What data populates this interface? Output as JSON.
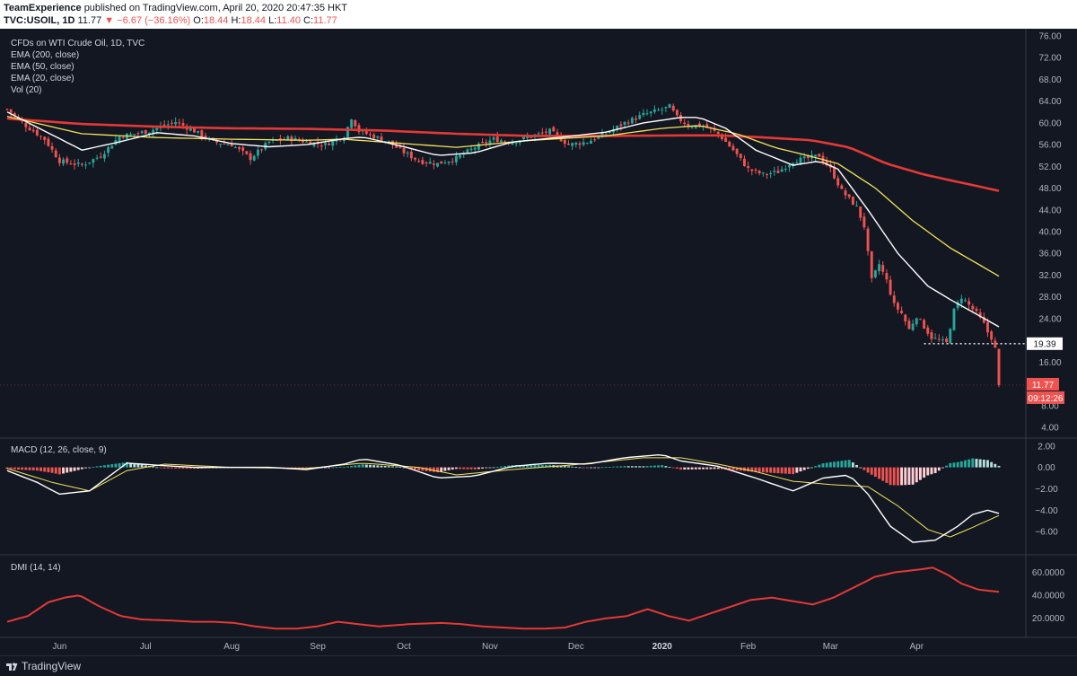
{
  "header": {
    "author": "TeamExperience",
    "published_text": "published on TradingView.com, April 20, 2020 20:47:35 HKT",
    "symbol": "TVC:USOIL, 1D",
    "last": "11.77",
    "change": "−6.67 (−36.16%)",
    "ohlc": {
      "o": "O:",
      "o_v": "18.44",
      "h": "H:",
      "h_v": "18.44",
      "l": "L:",
      "l_v": "11.40",
      "c": "C:",
      "c_v": "11.77"
    }
  },
  "footer": {
    "brand": "TradingView"
  },
  "chart_data": {
    "type": "line",
    "price_pane": {
      "title": "CFDs on WTI Crude Oil, 1D, TVC",
      "legend": [
        "EMA (200, close)",
        "EMA (50, close)",
        "EMA (20, close)",
        "Vol (20)"
      ],
      "ylim": [
        4,
        76
      ],
      "yticks": [
        76,
        72,
        68,
        64,
        60,
        56,
        52,
        48,
        44,
        40,
        36,
        32,
        28,
        24,
        20,
        16,
        12,
        8,
        4
      ],
      "ytick_labels": [
        "76.00",
        "72.00",
        "68.00",
        "64.00",
        "60.00",
        "56.00",
        "52.00",
        "48.00",
        "44.00",
        "40.00",
        "36.00",
        "32.00",
        "28.00",
        "24.00",
        "",
        "16.00",
        "",
        "8.00",
        "4.00"
      ],
      "close_anchors": [
        [
          0,
          62.5
        ],
        [
          5,
          59.5
        ],
        [
          10,
          57
        ],
        [
          14,
          53
        ],
        [
          20,
          52.2
        ],
        [
          25,
          54
        ],
        [
          30,
          57.5
        ],
        [
          34,
          58
        ],
        [
          38,
          58.5
        ],
        [
          42,
          59.5
        ],
        [
          45,
          60.2
        ],
        [
          50,
          58.5
        ],
        [
          55,
          56.5
        ],
        [
          60,
          56
        ],
        [
          65,
          53.5
        ],
        [
          70,
          56.5
        ],
        [
          75,
          57.2
        ],
        [
          80,
          56.5
        ],
        [
          85,
          56
        ],
        [
          88,
          57
        ],
        [
          90,
          57.5
        ],
        [
          92,
          61
        ],
        [
          94,
          58.5
        ],
        [
          98,
          57.5
        ],
        [
          102,
          56.5
        ],
        [
          105,
          55
        ],
        [
          110,
          53
        ],
        [
          115,
          52.5
        ],
        [
          120,
          53.5
        ],
        [
          125,
          55.5
        ],
        [
          130,
          57
        ],
        [
          135,
          56.5
        ],
        [
          140,
          57.5
        ],
        [
          145,
          58.5
        ],
        [
          150,
          56
        ],
        [
          155,
          56.5
        ],
        [
          160,
          58
        ],
        [
          165,
          60
        ],
        [
          170,
          61.5
        ],
        [
          175,
          62.5
        ],
        [
          177,
          63
        ],
        [
          179,
          61
        ],
        [
          182,
          59.5
        ],
        [
          186,
          59.5
        ],
        [
          190,
          58
        ],
        [
          194,
          55
        ],
        [
          198,
          51.5
        ],
        [
          202,
          50.5
        ],
        [
          206,
          51
        ],
        [
          210,
          53
        ],
        [
          214,
          53.5
        ],
        [
          217,
          54
        ],
        [
          220,
          51.5
        ],
        [
          223,
          47.5
        ],
        [
          225,
          46
        ],
        [
          227,
          44.5
        ],
        [
          229,
          41
        ],
        [
          231,
          31
        ],
        [
          233,
          34
        ],
        [
          235,
          31
        ],
        [
          237,
          26.5
        ],
        [
          239,
          25
        ],
        [
          241,
          22
        ],
        [
          243,
          24.5
        ],
        [
          245,
          22.5
        ],
        [
          247,
          20.5
        ],
        [
          249,
          20
        ],
        [
          251,
          19.5
        ],
        [
          253,
          25.5
        ],
        [
          255,
          28
        ],
        [
          257,
          26.5
        ],
        [
          259,
          25
        ],
        [
          261,
          23
        ],
        [
          262,
          21.5
        ],
        [
          263,
          20.5
        ],
        [
          264,
          18.4
        ],
        [
          265,
          11.77
        ]
      ],
      "ema200": [
        [
          0,
          60.8
        ],
        [
          20,
          59.8
        ],
        [
          40,
          59.3
        ],
        [
          60,
          59
        ],
        [
          80,
          58.9
        ],
        [
          100,
          58.6
        ],
        [
          120,
          58
        ],
        [
          140,
          57.6
        ],
        [
          160,
          57.6
        ],
        [
          180,
          57.7
        ],
        [
          190,
          57.7
        ],
        [
          200,
          57.4
        ],
        [
          215,
          56.8
        ],
        [
          225,
          55.5
        ],
        [
          235,
          52.5
        ],
        [
          245,
          50.5
        ],
        [
          255,
          49
        ],
        [
          265,
          47.5
        ]
      ],
      "ema50": [
        [
          0,
          61.2
        ],
        [
          20,
          58
        ],
        [
          40,
          57.3
        ],
        [
          60,
          57
        ],
        [
          80,
          56.8
        ],
        [
          90,
          57
        ],
        [
          100,
          56.5
        ],
        [
          120,
          55.5
        ],
        [
          140,
          56.8
        ],
        [
          160,
          57.6
        ],
        [
          175,
          59
        ],
        [
          185,
          59.5
        ],
        [
          195,
          58
        ],
        [
          205,
          55.5
        ],
        [
          215,
          53.8
        ],
        [
          222,
          52.5
        ],
        [
          232,
          48
        ],
        [
          242,
          42
        ],
        [
          252,
          37
        ],
        [
          265,
          31.8
        ]
      ],
      "ema20": [
        [
          0,
          62
        ],
        [
          10,
          58.5
        ],
        [
          20,
          55
        ],
        [
          30,
          56.5
        ],
        [
          40,
          58.2
        ],
        [
          50,
          57.6
        ],
        [
          60,
          56.2
        ],
        [
          70,
          55.6
        ],
        [
          80,
          56
        ],
        [
          90,
          57.1
        ],
        [
          95,
          57.4
        ],
        [
          105,
          55.8
        ],
        [
          115,
          54
        ],
        [
          125,
          54.5
        ],
        [
          135,
          56.5
        ],
        [
          150,
          57.5
        ],
        [
          160,
          58.3
        ],
        [
          170,
          60
        ],
        [
          180,
          61
        ],
        [
          185,
          61
        ],
        [
          192,
          59
        ],
        [
          200,
          55
        ],
        [
          210,
          52.2
        ],
        [
          217,
          53
        ],
        [
          222,
          51.5
        ],
        [
          230,
          44
        ],
        [
          238,
          36
        ],
        [
          246,
          30
        ],
        [
          252,
          27.5
        ],
        [
          258,
          25.2
        ],
        [
          265,
          22.5
        ]
      ],
      "hline_value": 19.39,
      "hline_label": "19.39",
      "last_label": "11.77",
      "countdown_label": "09:12:26"
    },
    "macd_pane": {
      "title": "MACD (12, 26, close, 9)",
      "ylim": [
        -8,
        2.4
      ],
      "yticks": [
        2,
        0,
        -2,
        -4,
        -6
      ],
      "ytick_labels": [
        "2.00",
        "0.00",
        "−2.00",
        "−4.00",
        "−6.00"
      ],
      "macd": [
        [
          0,
          -0.3
        ],
        [
          8,
          -1.4
        ],
        [
          14,
          -2.5
        ],
        [
          22,
          -2.2
        ],
        [
          32,
          0.4
        ],
        [
          40,
          0.2
        ],
        [
          50,
          0
        ],
        [
          60,
          0
        ],
        [
          70,
          0
        ],
        [
          80,
          -0.2
        ],
        [
          90,
          0.3
        ],
        [
          95,
          0.8
        ],
        [
          105,
          0.2
        ],
        [
          115,
          -1
        ],
        [
          125,
          -0.8
        ],
        [
          135,
          0.1
        ],
        [
          145,
          0.4
        ],
        [
          155,
          0.3
        ],
        [
          165,
          0.9
        ],
        [
          175,
          1.2
        ],
        [
          180,
          0.6
        ],
        [
          190,
          0.1
        ],
        [
          200,
          -1
        ],
        [
          210,
          -2.2
        ],
        [
          218,
          -1
        ],
        [
          225,
          -0.7
        ],
        [
          230,
          -2.5
        ],
        [
          236,
          -5.5
        ],
        [
          242,
          -7
        ],
        [
          248,
          -6.8
        ],
        [
          254,
          -5.5
        ],
        [
          258,
          -4.4
        ],
        [
          262,
          -4
        ],
        [
          265,
          -4.3
        ]
      ],
      "signal": [
        [
          0,
          -0.1
        ],
        [
          12,
          -1.4
        ],
        [
          22,
          -2.2
        ],
        [
          32,
          -0.3
        ],
        [
          42,
          0.3
        ],
        [
          60,
          0
        ],
        [
          80,
          -0.1
        ],
        [
          95,
          0.4
        ],
        [
          110,
          0
        ],
        [
          120,
          -0.7
        ],
        [
          135,
          -0.2
        ],
        [
          150,
          0.2
        ],
        [
          170,
          0.9
        ],
        [
          180,
          0.9
        ],
        [
          190,
          0.3
        ],
        [
          200,
          -0.4
        ],
        [
          210,
          -1.3
        ],
        [
          220,
          -1.6
        ],
        [
          230,
          -1.8
        ],
        [
          238,
          -3.6
        ],
        [
          246,
          -5.8
        ],
        [
          252,
          -6.5
        ],
        [
          258,
          -5.6
        ],
        [
          265,
          -4.5
        ]
      ]
    },
    "dmi_pane": {
      "title": "DMI (14, 14)",
      "ylim": [
        5,
        72
      ],
      "yticks": [
        60,
        40,
        20
      ],
      "ytick_labels": [
        "60.0000",
        "40.0000",
        "20.0000"
      ],
      "adx": [
        [
          0,
          17
        ],
        [
          10,
          22
        ],
        [
          20,
          34
        ],
        [
          28,
          38
        ],
        [
          35,
          40
        ],
        [
          45,
          30
        ],
        [
          55,
          22
        ],
        [
          65,
          19
        ],
        [
          80,
          18
        ],
        [
          90,
          17
        ],
        [
          100,
          17
        ],
        [
          110,
          16
        ],
        [
          120,
          13
        ],
        [
          130,
          11
        ],
        [
          140,
          11
        ],
        [
          150,
          13
        ],
        [
          160,
          17
        ],
        [
          170,
          15
        ],
        [
          180,
          13
        ],
        [
          195,
          15
        ],
        [
          210,
          16
        ],
        [
          220,
          15
        ],
        [
          230,
          13
        ],
        [
          240,
          12
        ],
        [
          250,
          11
        ],
        [
          260,
          11
        ],
        [
          270,
          12
        ],
        [
          280,
          17
        ],
        [
          290,
          20
        ],
        [
          300,
          22
        ],
        [
          310,
          28
        ],
        [
          320,
          22
        ],
        [
          330,
          18
        ],
        [
          340,
          24
        ],
        [
          350,
          30
        ],
        [
          360,
          36
        ],
        [
          370,
          38
        ],
        [
          380,
          35
        ],
        [
          390,
          32
        ],
        [
          400,
          38
        ],
        [
          410,
          47
        ],
        [
          420,
          56
        ],
        [
          430,
          60
        ],
        [
          440,
          62
        ],
        [
          448,
          64
        ],
        [
          455,
          58
        ],
        [
          462,
          50
        ],
        [
          470,
          45
        ],
        [
          480,
          43
        ]
      ]
    },
    "xticks": [
      {
        "label": "Jun",
        "i": 14
      },
      {
        "label": "Jul",
        "i": 37
      },
      {
        "label": "Aug",
        "i": 60
      },
      {
        "label": "Sep",
        "i": 83
      },
      {
        "label": "Oct",
        "i": 106
      },
      {
        "label": "Nov",
        "i": 129
      },
      {
        "label": "Dec",
        "i": 152
      },
      {
        "label": "2020",
        "i": 175
      },
      {
        "label": "Feb",
        "i": 198
      },
      {
        "label": "Mar",
        "i": 220
      },
      {
        "label": "Apr",
        "i": 243
      }
    ],
    "colors": {
      "up": "#26a69a",
      "down": "#ef5350",
      "ema200": "#e53935",
      "ema50": "#f5e35b",
      "ema20": "#ffffff",
      "macd": "#ffffff",
      "signal": "#f5e35b",
      "adx": "#e53935",
      "hist_up_strong": "#26a69a",
      "hist_up_weak": "#b2dfdb",
      "hist_dn_strong": "#ef5350",
      "hist_dn_weak": "#ffcdd2"
    }
  }
}
